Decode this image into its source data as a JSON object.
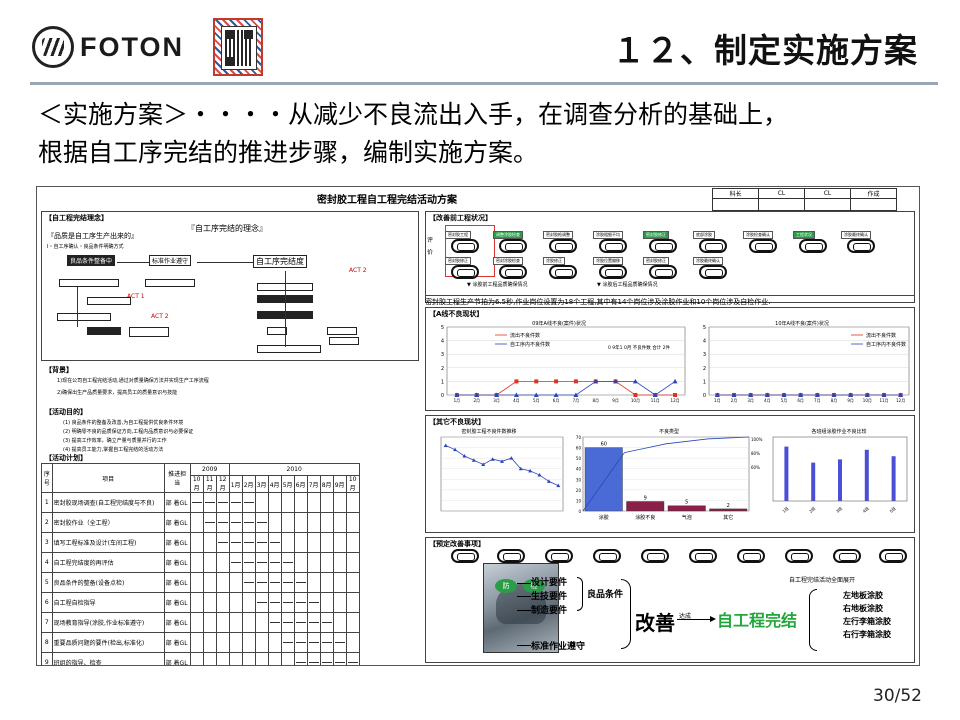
{
  "header": {
    "brand": "FOTON",
    "title": "１２、制定实施方案"
  },
  "intro": {
    "line1": "＜实施方案＞・・・・从减少不良流出入手，在调查分析的基础上，",
    "line2": "根据自工序完结的推进步骤，编制实施方案。"
  },
  "sheet": {
    "title": "密封胶工程自工程完结活动方案",
    "stamps": [
      "科长",
      "CL",
      "CL",
      "作成"
    ],
    "left": {
      "concept_header": "【自工程完结理念】",
      "concept_quote": "『自工序完结的理念』",
      "concept_sub": "『品质是自工序生产出来的』",
      "concept_flow": "Ⅰ・自工序确认・良品条件明确方式",
      "boxes": [
        "良品条件整备中",
        "标准作业遵守",
        "自工序完结度"
      ],
      "act_labels": [
        "ACT 2",
        "ACT 1",
        "ACT 2"
      ],
      "background_header": "【背景】",
      "background_text_1": "1)现在公司自工程完结活动,通过对质量确保方法并实现生产工序流程",
      "background_text_2": "2)确保出生产品质量要求，提高员工的质量意识与技能",
      "goal_header": "【活动目的】",
      "goals": [
        "(1) 良品条件的整备及改善,为自工程提供优良条件环境",
        "(2) 明确零不良的品质保证方向,工程内品质意识与必要保证",
        "(3) 提高工作效率，确立产量与质量并行的工作",
        "(4) 提高员工能力,掌握自工程完结的活动方法"
      ],
      "plan_header": "【活动计划】",
      "plan": {
        "col_no": "序号",
        "col_item": "项目",
        "col_owner": "推进担当",
        "year1": "2009",
        "year2": "2010",
        "months": [
          "10月",
          "11月",
          "12月",
          "1月",
          "2月",
          "3月",
          "4月",
          "5月",
          "6月",
          "7月",
          "8月",
          "9月",
          "10月"
        ],
        "rows": [
          {
            "no": "1",
            "item": "密封胶现场调查(自工程完结度与不良) ",
            "owner": "部 着GL"
          },
          {
            "no": "2",
            "item": "密封胶作业（全工程）",
            "owner": "部 着GL"
          },
          {
            "no": "3",
            "item": "填写工程标准及设计(车间工程)",
            "owner": "部 着GL"
          },
          {
            "no": "4",
            "item": "自工程完结度的再评估",
            "owner": "部 着GL"
          },
          {
            "no": "5",
            "item": "良品条件的整备(设备点检)",
            "owner": "部 着GL"
          },
          {
            "no": "6",
            "item": "自工程自检指导",
            "owner": "部 着GL"
          },
          {
            "no": "7",
            "item": "现场教育指导(涂胶,作业标准遵守)",
            "owner": "部 着GL"
          },
          {
            "no": "8",
            "item": "重要品质问题的要件(检出,标准化)",
            "owner": "部 着GL"
          },
          {
            "no": "9",
            "item": "班组的指导、检查",
            "owner": "部 着GL"
          },
          {
            "no": "10",
            "item": "自工程完结活动的定量评价",
            "owner": "部 着GL"
          }
        ]
      }
    },
    "right": {
      "improve_header": "【改善前工程状况】",
      "side_label": "评价",
      "pill_labels": [
        "密封胶工程",
        "调整涂胶检查",
        "密封胶枪调整",
        "涂胶粗细不均",
        "密封胶修正",
        "底部涂胶",
        "涂胶检查确认",
        "工程状况",
        "涂胶最终确认"
      ],
      "pill_labels_2": [
        "密封胶修正",
        "密封涂胶检查",
        "涂胶修正",
        "涂胶位置偏移",
        "密封胶修正",
        "涂胶最终确认"
      ],
      "legend_a": "涂胶前工程品质确保情况",
      "legend_b": "涂胶后工程品质确保情况",
      "summary": "密封胶工程生产节拍为6.5秒,作业岗位设置为18个工程,其中有14个岗位涉及涂胶作业和10个岗位涉及自检作业.",
      "defect_header": "【A线不良现状】",
      "chart1_title": "09年A线不良(案件)状况",
      "chart1_legend": [
        "流出不良件数",
        "自工序内不良件数"
      ],
      "chart1_note": "0 9年1 0月 不良件数 合计 2件",
      "chart2_title": "10年A线不良(案件)状况",
      "chart2_legend": [
        "流出不良件数",
        "自工序内不良件数"
      ],
      "defect2_header": "【其它不良现状】",
      "chart3_title": "密封胶工程不良件数推移",
      "chart4_title": "不良类型",
      "chart5_title": "各班组涂胶作业不良比较",
      "pareto_categories": [
        "涂胶",
        "涂胶不良",
        "气泡",
        "其它"
      ],
      "pareto_values": [
        "60",
        "9",
        "5",
        "2"
      ],
      "pareto_percent": [
        "100%",
        "80%",
        "60%"
      ],
      "bar_categories": [
        "1班",
        "2班",
        "3班",
        "4班",
        "5班"
      ],
      "flow_header": "【预定改善事项】",
      "bubbles": [
        "防",
        "检"
      ],
      "flow_items": [
        "设计要件",
        "生技要件",
        "制造要件"
      ],
      "flow_good": "良品条件",
      "flow_std": "标准作业遵守",
      "kaizen": "改善",
      "achieve": "达成",
      "result": "自工程完结",
      "deploy_title": "自工程完结活动全面展开",
      "deploy_list": [
        "左地板涂胶",
        "右地板涂胶",
        "左行李箱涂胶",
        "右行李箱涂胶"
      ]
    }
  },
  "chart_data": [
    {
      "type": "line",
      "title": "09年A线不良(案件)状况",
      "categories": [
        "1月",
        "2月",
        "3月",
        "4月",
        "5月",
        "6月",
        "7月",
        "8月",
        "9月",
        "10月",
        "11月",
        "12月"
      ],
      "series": [
        {
          "name": "流出不良件数",
          "values": [
            0,
            0,
            0,
            1,
            1,
            1,
            1,
            1,
            1,
            0,
            0,
            0
          ]
        },
        {
          "name": "自工序内不良件数",
          "values": [
            0,
            0,
            0,
            0,
            0,
            0,
            0,
            1,
            1,
            1,
            0,
            1
          ]
        }
      ],
      "ylim": [
        0,
        5
      ]
    },
    {
      "type": "line",
      "title": "10年A线不良(案件)状况",
      "categories": [
        "1月",
        "2月",
        "3月",
        "4月",
        "5月",
        "6月",
        "7月",
        "8月",
        "9月",
        "10月",
        "11月",
        "12月"
      ],
      "series": [
        {
          "name": "流出不良件数",
          "values": [
            0,
            0,
            0,
            0,
            0,
            0,
            0,
            0,
            0,
            0,
            0,
            0
          ]
        },
        {
          "name": "自工序内不良件数",
          "values": [
            0,
            0,
            0,
            0,
            0,
            0,
            0,
            0,
            0,
            0,
            0,
            0
          ]
        }
      ],
      "ylim": [
        0,
        5
      ]
    },
    {
      "type": "bar",
      "title": "不良类型",
      "categories": [
        "涂胶",
        "涂胶不良",
        "气泡",
        "其它"
      ],
      "values": [
        60,
        9,
        5,
        2
      ],
      "ylim": [
        0,
        70
      ]
    }
  ]
}
